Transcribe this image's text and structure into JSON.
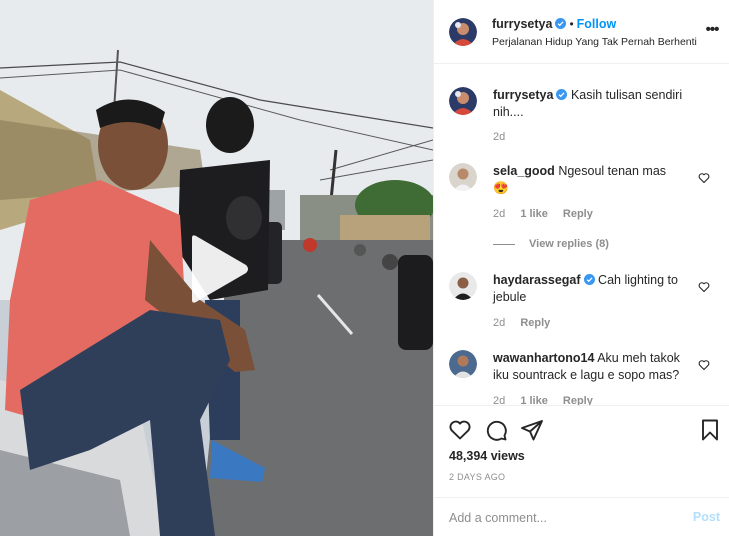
{
  "post_header": {
    "username": "furrysetya",
    "follow_label": "Follow",
    "separator": "•",
    "location": "Perjalanan Hidup Yang Tak Pernah Berhenti",
    "more_label": "•••"
  },
  "comments": [
    {
      "username": "furrysetya",
      "verified": true,
      "text": "Kasih tulisan sendiri nih....",
      "time": "2d"
    },
    {
      "username": "sela_good",
      "verified": false,
      "text": "Ngesoul tenan mas",
      "emoji": "😍",
      "time": "2d",
      "likes": "1 like",
      "reply_label": "Reply",
      "view_replies": "View replies (8)"
    },
    {
      "username": "haydarassegaf",
      "verified": true,
      "text": "Cah lighting to jebule",
      "time": "2d",
      "reply_label": "Reply"
    },
    {
      "username": "wawanhartono14",
      "verified": false,
      "text": "Aku meh takok iku sountrack e lagu e sopo mas?",
      "time": "2d",
      "likes": "1 like",
      "reply_label": "Reply"
    }
  ],
  "stats": {
    "views": "48,394 views",
    "date": "2 DAYS AGO"
  },
  "composer": {
    "placeholder": "Add a comment...",
    "post_label": "Post"
  },
  "icons": {
    "like": "heart-icon",
    "comment": "comment-bubble-icon",
    "share": "paper-plane-icon",
    "save": "bookmark-icon",
    "play": "play-icon",
    "verified": "verified-badge-icon"
  },
  "colors": {
    "link_blue": "#0095f6",
    "verified_blue": "#3897f0",
    "muted": "#8e8e8e",
    "post_disabled": "#b2dffc"
  }
}
